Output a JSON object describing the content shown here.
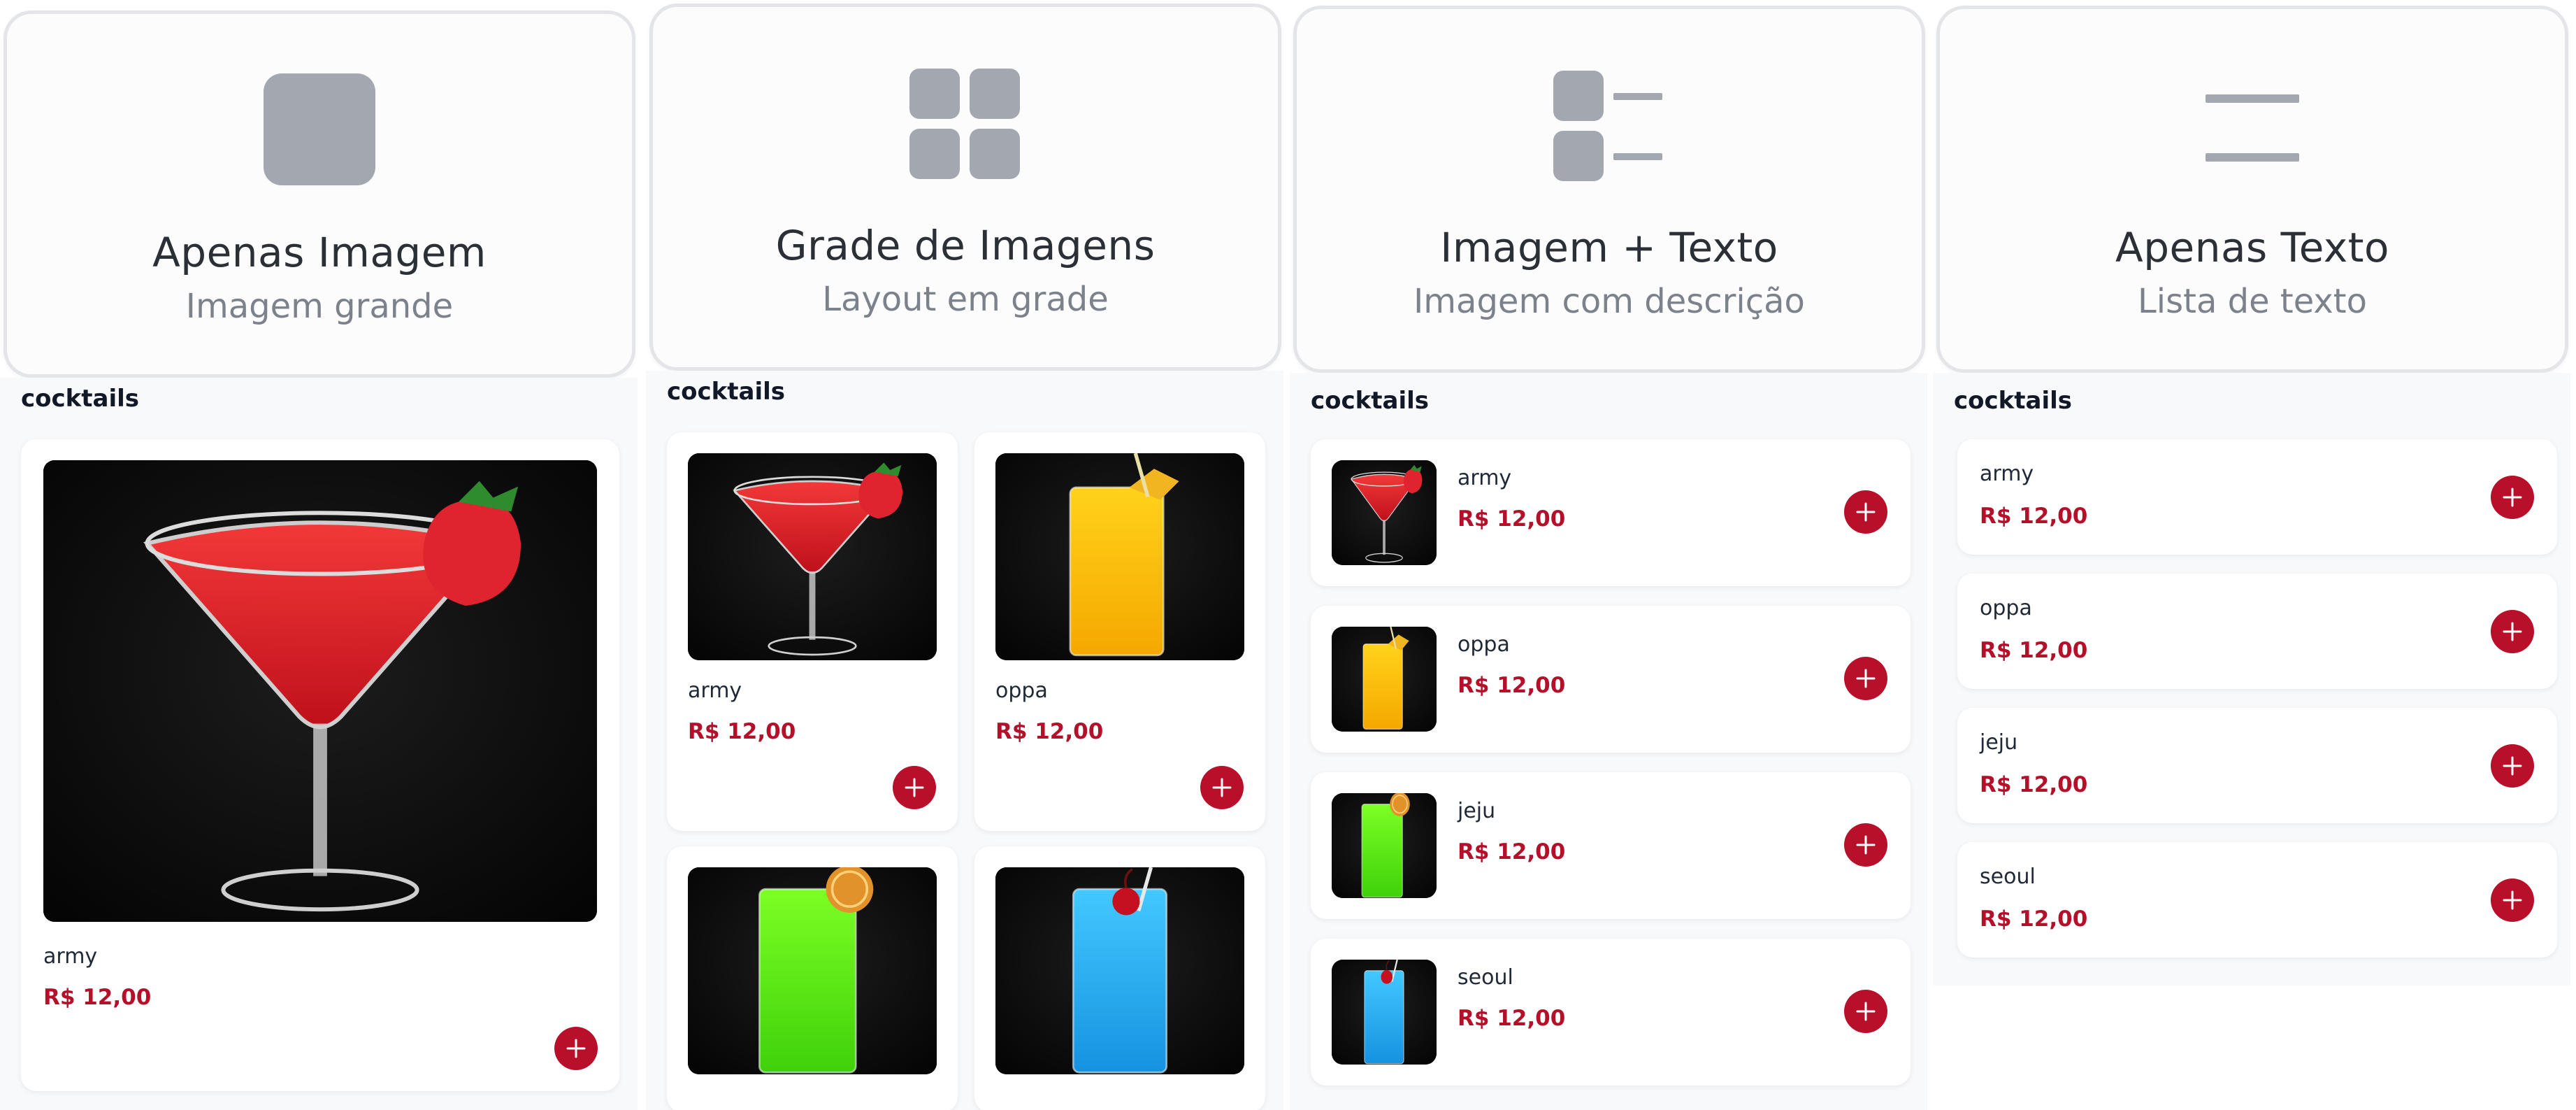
{
  "layouts": [
    {
      "title": "Apenas Imagem",
      "subtitle": "Imagem grande",
      "icon": "single-image-icon"
    },
    {
      "title": "Grade de Imagens",
      "subtitle": "Layout em grade",
      "icon": "grid-icon"
    },
    {
      "title": "Imagem + Texto",
      "subtitle": "Imagem com descrição",
      "icon": "image-text-icon"
    },
    {
      "title": "Apenas Texto",
      "subtitle": "Lista de texto",
      "icon": "text-list-icon"
    }
  ],
  "category": "cocktails",
  "items": [
    {
      "name": "army",
      "price": "R$ 12,00",
      "drink": "red-martini"
    },
    {
      "name": "oppa",
      "price": "R$ 12,00",
      "drink": "yellow-highball"
    },
    {
      "name": "jeju",
      "price": "R$ 12,00",
      "drink": "green-highball"
    },
    {
      "name": "seoul",
      "price": "R$ 12,00",
      "drink": "blue-highball"
    }
  ],
  "colors": {
    "accent": "#b8102a",
    "price": "#b5102a",
    "icon_gray": "#a2a7b0",
    "card_border": "#e3e5e9"
  }
}
